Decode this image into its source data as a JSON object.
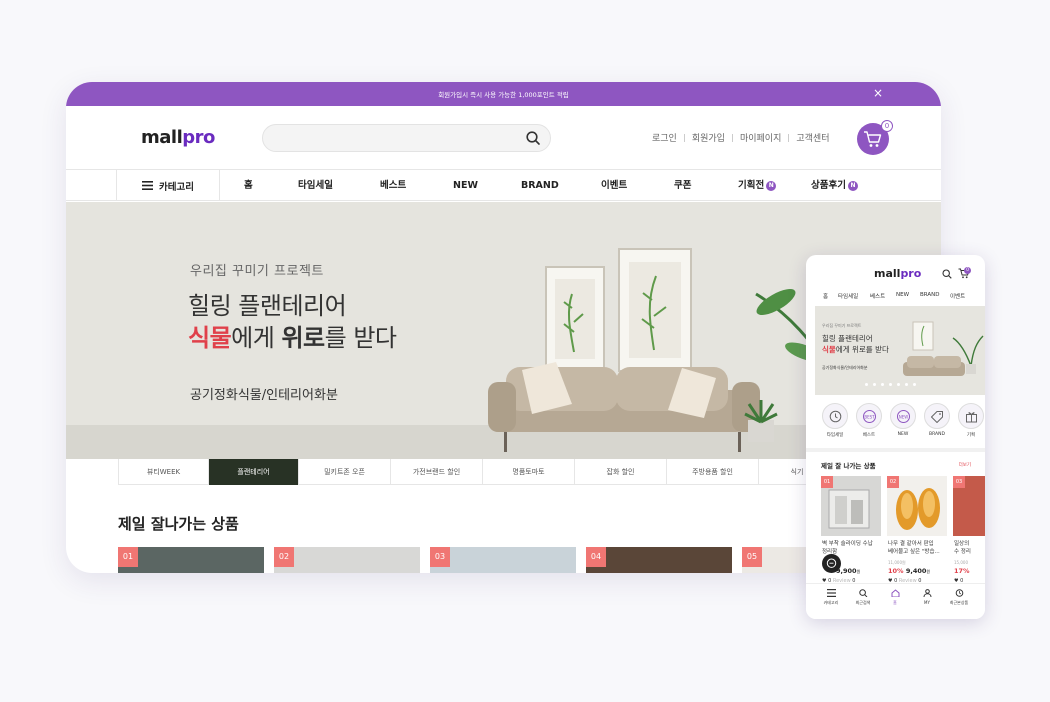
{
  "topbar": {
    "notice": "회원가입시 즉시 사용 가능한 1,000포인트 적립",
    "close": "×"
  },
  "header": {
    "logo_main": "mall",
    "logo_accent": "pro",
    "search_placeholder": "",
    "util_links": [
      "로그인",
      "회원가입",
      "마이페이지",
      "고객센터"
    ],
    "cart_count": "0"
  },
  "nav": {
    "category_label": "카테고리",
    "items": [
      "홈",
      "타임세일",
      "베스트",
      "NEW",
      "BRAND",
      "이벤트",
      "쿠폰",
      "기획전",
      "상품후기"
    ],
    "new_badge": "N"
  },
  "hero": {
    "subtitle": "우리집 꾸미기 프로젝트",
    "title_line1": "힐링 플랜테리어",
    "title_line2_red": "식물",
    "title_line2_a": "에게 ",
    "title_line2_bold": "위로",
    "title_line2_b": "를 받다",
    "description": "공기정화식물/인테리어화분"
  },
  "tabs": [
    "뷰티WEEK",
    "플랜테리어",
    "밀키트존 오픈",
    "가전브랜드 할인",
    "명품토마토",
    "잡화 할인",
    "주방용품 할인",
    "식기 세일"
  ],
  "best": {
    "title": "제일 잘나가는 상품",
    "ranks": [
      "01",
      "02",
      "03",
      "04",
      "05"
    ]
  },
  "mobile": {
    "logo_main": "mall",
    "logo_accent": "pro",
    "cart_count": "0",
    "nav": [
      "홈",
      "타임세일",
      "베스트",
      "NEW",
      "BRAND",
      "이벤트"
    ],
    "hero": {
      "subtitle": "우리집 꾸미기 프로젝트",
      "line1": "힐링 플랜테리어",
      "line2_red": "식물",
      "line2_rest": "에게 위로를 받다",
      "desc": "공기정화식물/인테리어화분"
    },
    "categories": [
      "타임세일",
      "베스트",
      "NEW",
      "BRAND",
      "기획"
    ],
    "section_title": "제일 잘 나가는 상품",
    "more": "더보기",
    "products": [
      {
        "rank": "01",
        "name_line1": "벽 부착 슬라이딩 수납",
        "name_line2": "정리함",
        "original": "",
        "discount": "",
        "price": "9,900",
        "unit": "원",
        "likes": "0",
        "review_label": "Review",
        "reviews": "0"
      },
      {
        "rank": "02",
        "name_line1": "나무 결 같아서 판입",
        "name_line2": "베어물고 싶은 \"방습...",
        "original": "11,000원",
        "discount": "10%",
        "price": "9,400",
        "unit": "원",
        "likes": "0",
        "review_label": "Review",
        "reviews": "0"
      },
      {
        "rank": "03",
        "name_line1": "일상의",
        "name_line2": "수 정리",
        "original": "15,000",
        "discount": "17%",
        "price": "",
        "unit": "",
        "likes": "0",
        "review_label": "",
        "reviews": ""
      }
    ],
    "bottom_bar": [
      "카테고리",
      "최근검색",
      "홈",
      "MY",
      "최근본상품"
    ]
  }
}
